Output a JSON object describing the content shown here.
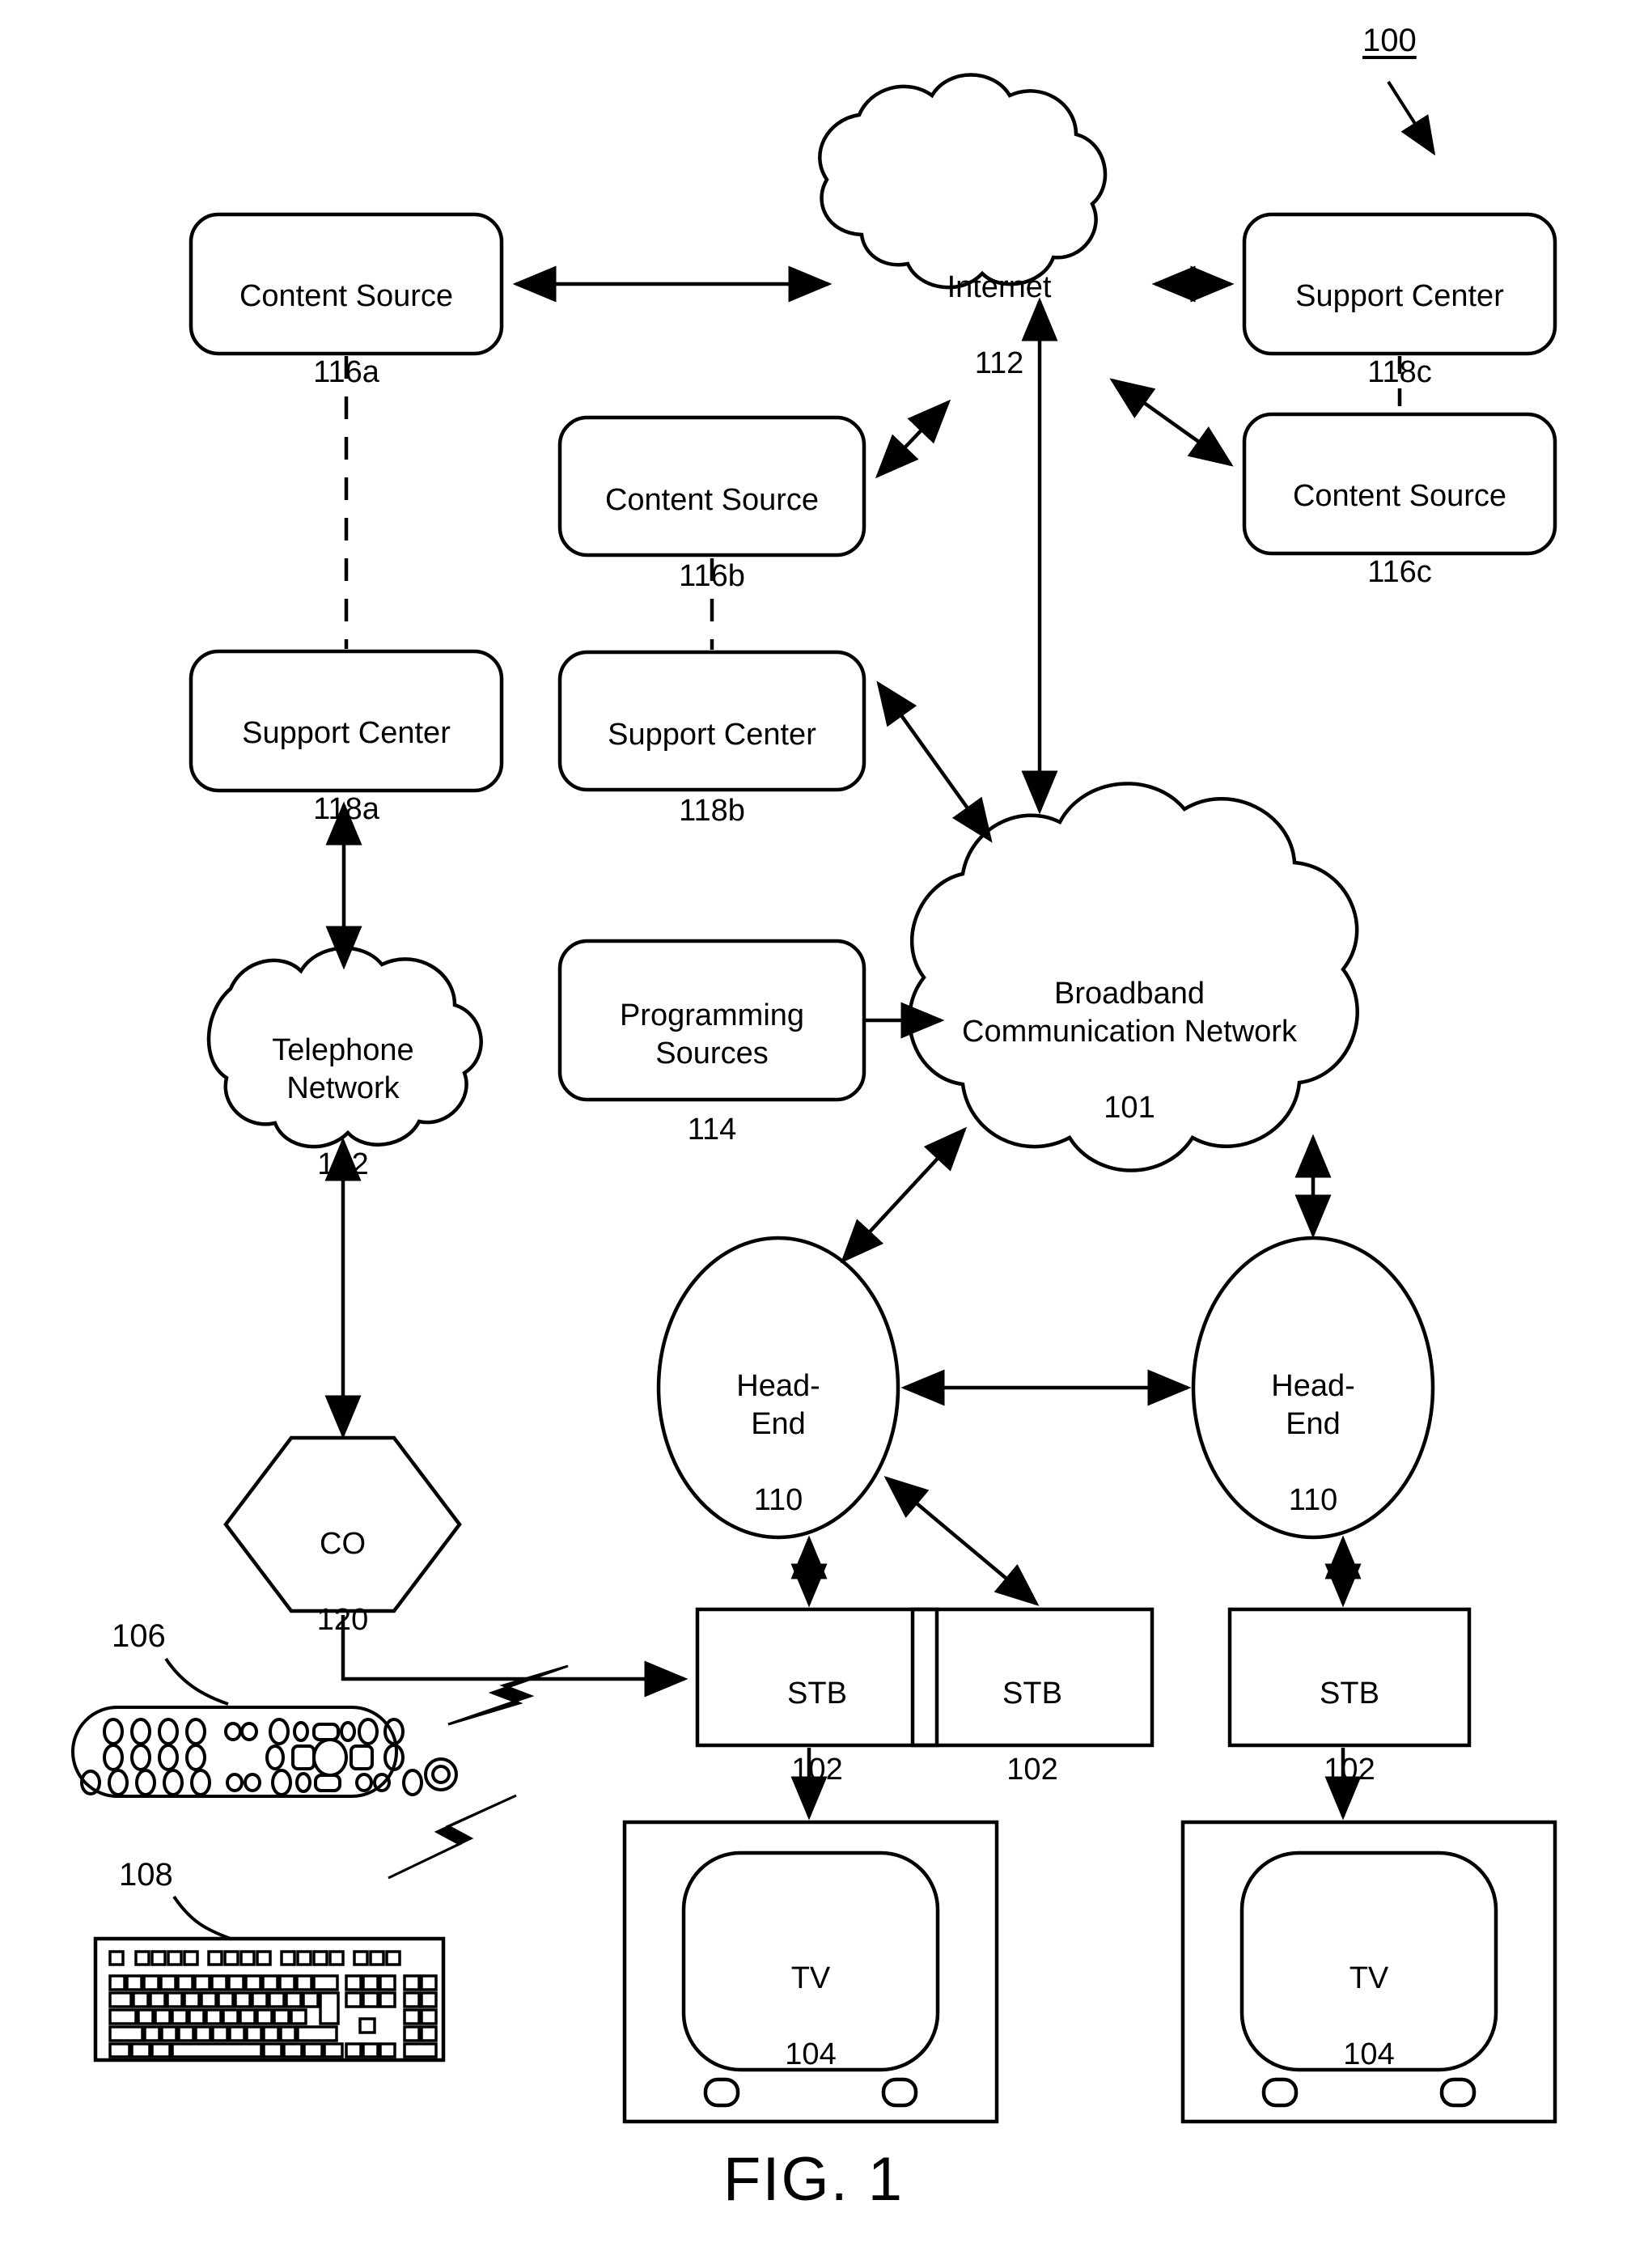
{
  "figure": {
    "caption": "FIG. 1",
    "system_ref": "100"
  },
  "nodes": {
    "content_source_a": {
      "title": "Content Source",
      "ref": "116a",
      "shape": "rounded-rect"
    },
    "content_source_b": {
      "title": "Content Source",
      "ref": "116b",
      "shape": "rounded-rect"
    },
    "content_source_c": {
      "title": "Content Source",
      "ref": "116c",
      "shape": "rounded-rect"
    },
    "support_center_a": {
      "title": "Support Center",
      "ref": "118a",
      "shape": "rounded-rect"
    },
    "support_center_b": {
      "title": "Support Center",
      "ref": "118b",
      "shape": "rounded-rect"
    },
    "support_center_c": {
      "title": "Support Center",
      "ref": "118c",
      "shape": "rounded-rect"
    },
    "internet": {
      "title": "Internet",
      "ref": "112",
      "shape": "cloud"
    },
    "broadband_network": {
      "title": "Broadband\nCommunication Network",
      "ref": "101",
      "shape": "cloud"
    },
    "telephone_network": {
      "title": "Telephone\nNetwork",
      "ref": "122",
      "shape": "cloud"
    },
    "programming_sources": {
      "title": "Programming\nSources",
      "ref": "114",
      "shape": "rounded-rect"
    },
    "central_office": {
      "title": "CO",
      "ref": "120",
      "shape": "hexagon"
    },
    "head_end_left": {
      "title": "Head-\nEnd",
      "ref": "110",
      "shape": "ellipse"
    },
    "head_end_right": {
      "title": "Head-\nEnd",
      "ref": "110",
      "shape": "ellipse"
    },
    "stb_1": {
      "title": "STB",
      "ref": "102",
      "shape": "rect"
    },
    "stb_2": {
      "title": "STB",
      "ref": "102",
      "shape": "rect"
    },
    "stb_3": {
      "title": "STB",
      "ref": "102",
      "shape": "rect"
    },
    "tv_1": {
      "title": "TV",
      "ref": "104",
      "shape": "tv"
    },
    "tv_2": {
      "title": "TV",
      "ref": "104",
      "shape": "tv"
    },
    "remote_control": {
      "ref": "106",
      "shape": "remote"
    },
    "keyboard": {
      "ref": "108",
      "shape": "keyboard"
    }
  },
  "connections": [
    {
      "from": "content_source_a",
      "to": "internet",
      "style": "solid",
      "arrow": "both"
    },
    {
      "from": "internet",
      "to": "support_center_c",
      "style": "solid",
      "arrow": "both"
    },
    {
      "from": "content_source_b",
      "to": "internet",
      "style": "solid",
      "arrow": "both"
    },
    {
      "from": "content_source_c",
      "to": "internet",
      "style": "solid",
      "arrow": "both"
    },
    {
      "from": "support_center_c",
      "to": "content_source_c",
      "style": "dashed",
      "arrow": "none"
    },
    {
      "from": "content_source_a",
      "to": "support_center_a",
      "style": "dashed",
      "arrow": "none"
    },
    {
      "from": "content_source_b",
      "to": "support_center_b",
      "style": "dashed",
      "arrow": "none"
    },
    {
      "from": "internet",
      "to": "broadband_network",
      "style": "solid",
      "arrow": "both"
    },
    {
      "from": "support_center_b",
      "to": "broadband_network",
      "style": "solid",
      "arrow": "both"
    },
    {
      "from": "support_center_a",
      "to": "telephone_network",
      "style": "solid",
      "arrow": "both"
    },
    {
      "from": "telephone_network",
      "to": "central_office",
      "style": "solid",
      "arrow": "both"
    },
    {
      "from": "programming_sources",
      "to": "broadband_network",
      "style": "solid",
      "arrow": "single"
    },
    {
      "from": "broadband_network",
      "to": "head_end_left",
      "style": "solid",
      "arrow": "both"
    },
    {
      "from": "broadband_network",
      "to": "head_end_right",
      "style": "solid",
      "arrow": "both"
    },
    {
      "from": "head_end_left",
      "to": "head_end_right",
      "style": "solid",
      "arrow": "both"
    },
    {
      "from": "head_end_left",
      "to": "stb_1",
      "style": "solid",
      "arrow": "both"
    },
    {
      "from": "head_end_left",
      "to": "stb_2",
      "style": "solid",
      "arrow": "both"
    },
    {
      "from": "head_end_right",
      "to": "stb_3",
      "style": "solid",
      "arrow": "both"
    },
    {
      "from": "central_office",
      "to": "stb_1",
      "style": "solid",
      "arrow": "single"
    },
    {
      "from": "stb_1",
      "to": "tv_1",
      "style": "solid",
      "arrow": "single"
    },
    {
      "from": "stb_3",
      "to": "tv_2",
      "style": "solid",
      "arrow": "single"
    },
    {
      "from": "remote_control",
      "to": "stb_1",
      "style": "wireless",
      "arrow": "none"
    },
    {
      "from": "keyboard",
      "to": "stb_1",
      "style": "wireless",
      "arrow": "none"
    }
  ],
  "colors": {
    "stroke": "#000000",
    "background": "#ffffff",
    "text": "#000000"
  }
}
